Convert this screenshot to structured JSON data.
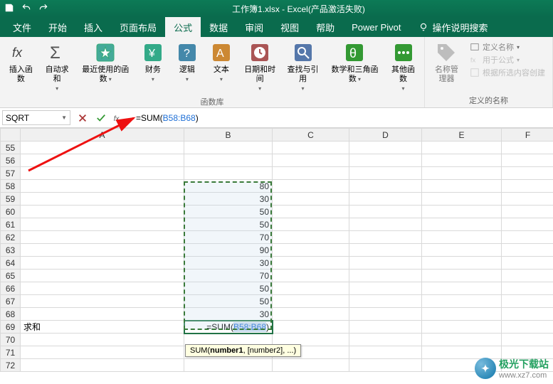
{
  "title": "工作簿1.xlsx - Excel(产品激活失败)",
  "tabs": [
    "文件",
    "开始",
    "插入",
    "页面布局",
    "公式",
    "数据",
    "审阅",
    "视图",
    "帮助",
    "Power Pivot"
  ],
  "active_tab_index": 4,
  "tell_me": "操作说明搜索",
  "ribbon": {
    "insert_fn": "插入函数",
    "autosum": "自动求和",
    "recent": "最近使用的函数",
    "financial": "财务",
    "logical": "逻辑",
    "text": "文本",
    "datetime": "日期和时间",
    "lookup": "查找与引用",
    "math": "数学和三角函数",
    "more": "其他函数",
    "lib_label": "函数库",
    "name_mgr": "名称管理器",
    "define_name": "定义名称",
    "use_in_formula": "用于公式",
    "create_from_sel": "根据所选内容创建",
    "names_label": "定义的名称"
  },
  "formula_bar": {
    "namebox": "SQRT",
    "formula_prefix": "=SUM(",
    "formula_ref": "B58:B68",
    "formula_suffix": ")"
  },
  "columns": [
    "A",
    "B",
    "C",
    "D",
    "E",
    "F"
  ],
  "rows": [
    55,
    56,
    57,
    58,
    59,
    60,
    61,
    62,
    63,
    64,
    65,
    66,
    67,
    68,
    69,
    70,
    71,
    72
  ],
  "cells": {
    "B58": 80,
    "B59": 30,
    "B60": 50,
    "B61": 50,
    "B62": 70,
    "B63": 90,
    "B64": 30,
    "B65": 70,
    "B66": 50,
    "B67": 50,
    "B68": 30,
    "A69": "求和"
  },
  "formula_cell": {
    "addr": "B69",
    "display_prefix": "=SUM(",
    "display_ref": "B58:B68",
    "display_suffix": ")"
  },
  "tooltip": {
    "fn": "SUM",
    "arg1": "number1",
    "rest": ", [number2], ...)"
  },
  "watermark": {
    "name": "极光下载站",
    "url": "www.xz7.com"
  }
}
